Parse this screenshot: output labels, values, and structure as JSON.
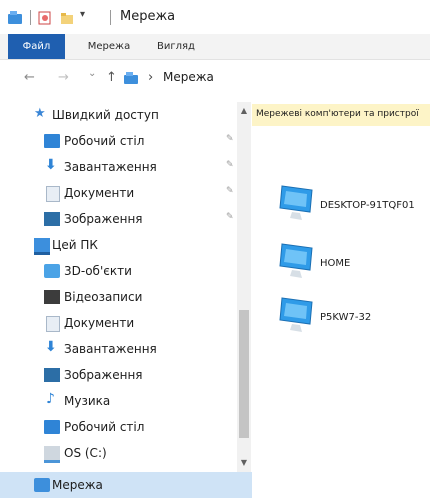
{
  "window": {
    "title": "Мережа"
  },
  "ribbon": {
    "file_label": "Файл",
    "tabs": [
      "Мережа",
      "Вигляд"
    ]
  },
  "address_bar": {
    "back_glyph": "←",
    "forward_glyph": "→",
    "recent_glyph": "⌄",
    "up_glyph": "↑",
    "crumb_separator": "›",
    "path": "Мережа"
  },
  "nav_pane": {
    "items": [
      {
        "label": "Швидкий доступ",
        "icon": "star-icon",
        "pinned": false
      },
      {
        "label": "Робочий стіл",
        "icon": "desktop-folder-icon",
        "pinned": true
      },
      {
        "label": "Завантаження",
        "icon": "downloads-icon",
        "pinned": true
      },
      {
        "label": "Документи",
        "icon": "documents-icon",
        "pinned": true
      },
      {
        "label": "Зображення",
        "icon": "pictures-icon",
        "pinned": true
      },
      {
        "label": "Цей ПК",
        "icon": "computer-icon",
        "pinned": false
      },
      {
        "label": "3D-об'єкти",
        "icon": "3d-objects-icon",
        "pinned": false
      },
      {
        "label": "Відеозаписи",
        "icon": "videos-icon",
        "pinned": false
      },
      {
        "label": "Документи",
        "icon": "documents-icon",
        "pinned": false
      },
      {
        "label": "Завантаження",
        "icon": "downloads-icon",
        "pinned": false
      },
      {
        "label": "Зображення",
        "icon": "pictures-icon",
        "pinned": false
      },
      {
        "label": "Музика",
        "icon": "music-icon",
        "pinned": false
      },
      {
        "label": "Робочий стіл",
        "icon": "desktop-folder-icon",
        "pinned": false
      },
      {
        "label": "OS (C:)",
        "icon": "drive-icon",
        "pinned": false
      },
      {
        "label": "Мережа",
        "icon": "network-icon",
        "pinned": false,
        "selected": true
      }
    ],
    "pin_glyph": "✎"
  },
  "content": {
    "group_header": "Мережеві комп'ютери та пристрої",
    "devices": [
      {
        "name": "DESKTOP-91TQF01",
        "icon": "computer-monitor-icon"
      },
      {
        "name": "HOME",
        "icon": "computer-monitor-icon"
      },
      {
        "name": "P5KW7-32",
        "icon": "computer-monitor-icon"
      }
    ]
  },
  "colors": {
    "accent": "#1f5fb0",
    "selection": "#cfe3f6",
    "header_strip": "#fdf4c7"
  }
}
